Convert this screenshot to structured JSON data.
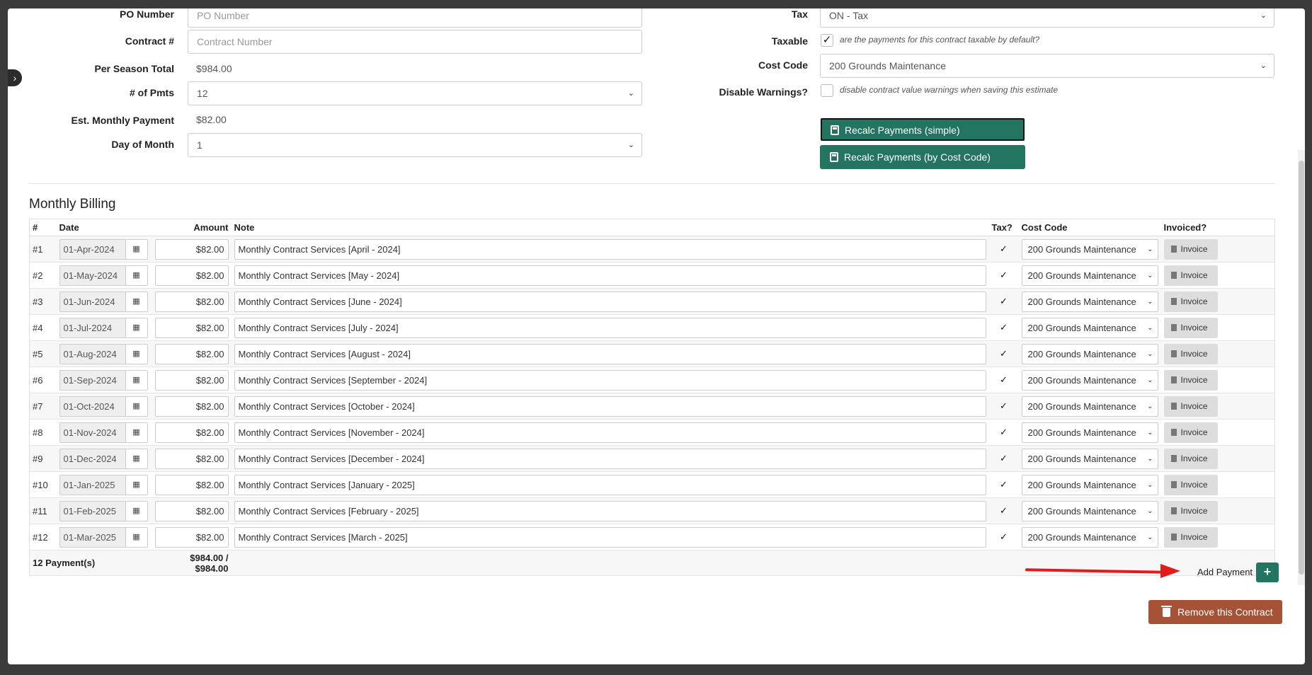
{
  "form": {
    "po_number": {
      "label": "PO Number",
      "placeholder": "PO Number"
    },
    "contract_no": {
      "label": "Contract #",
      "placeholder": "Contract Number"
    },
    "per_season_total": {
      "label": "Per Season Total",
      "value": "$984.00"
    },
    "num_pmts": {
      "label": "# of Pmts",
      "value": "12"
    },
    "est_monthly": {
      "label": "Est. Monthly Payment",
      "value": "$82.00"
    },
    "day_of_month": {
      "label": "Day of Month",
      "value": "1"
    },
    "tax": {
      "label": "Tax",
      "value": "ON - Tax"
    },
    "taxable": {
      "label": "Taxable",
      "checked": true,
      "hint": "are the payments for this contract taxable by default?"
    },
    "cost_code": {
      "label": "Cost Code",
      "value": "200 Grounds Maintenance"
    },
    "disable_warnings": {
      "label": "Disable Warnings?",
      "checked": false,
      "hint": "disable contract value warnings when saving this estimate"
    },
    "recalc_simple": "Recalc Payments (simple)",
    "recalc_cost_code": "Recalc Payments (by Cost Code)"
  },
  "billing": {
    "title": "Monthly Billing",
    "headers": {
      "num": "#",
      "date": "Date",
      "amount": "Amount",
      "note": "Note",
      "tax": "Tax?",
      "cost_code": "Cost Code",
      "invoiced": "Invoiced?"
    },
    "rows": [
      {
        "num": "#1",
        "date": "01-Apr-2024",
        "amount": "$82.00",
        "note": "Monthly Contract Services [April - 2024]",
        "tax": true,
        "cost_code": "200 Grounds Maintenance",
        "invoice": "Invoice"
      },
      {
        "num": "#2",
        "date": "01-May-2024",
        "amount": "$82.00",
        "note": "Monthly Contract Services [May - 2024]",
        "tax": true,
        "cost_code": "200 Grounds Maintenance",
        "invoice": "Invoice"
      },
      {
        "num": "#3",
        "date": "01-Jun-2024",
        "amount": "$82.00",
        "note": "Monthly Contract Services [June - 2024]",
        "tax": true,
        "cost_code": "200 Grounds Maintenance",
        "invoice": "Invoice"
      },
      {
        "num": "#4",
        "date": "01-Jul-2024",
        "amount": "$82.00",
        "note": "Monthly Contract Services [July - 2024]",
        "tax": true,
        "cost_code": "200 Grounds Maintenance",
        "invoice": "Invoice"
      },
      {
        "num": "#5",
        "date": "01-Aug-2024",
        "amount": "$82.00",
        "note": "Monthly Contract Services [August - 2024]",
        "tax": true,
        "cost_code": "200 Grounds Maintenance",
        "invoice": "Invoice"
      },
      {
        "num": "#6",
        "date": "01-Sep-2024",
        "amount": "$82.00",
        "note": "Monthly Contract Services [September - 2024]",
        "tax": true,
        "cost_code": "200 Grounds Maintenance",
        "invoice": "Invoice"
      },
      {
        "num": "#7",
        "date": "01-Oct-2024",
        "amount": "$82.00",
        "note": "Monthly Contract Services [October - 2024]",
        "tax": true,
        "cost_code": "200 Grounds Maintenance",
        "invoice": "Invoice"
      },
      {
        "num": "#8",
        "date": "01-Nov-2024",
        "amount": "$82.00",
        "note": "Monthly Contract Services [November - 2024]",
        "tax": true,
        "cost_code": "200 Grounds Maintenance",
        "invoice": "Invoice"
      },
      {
        "num": "#9",
        "date": "01-Dec-2024",
        "amount": "$82.00",
        "note": "Monthly Contract Services [December - 2024]",
        "tax": true,
        "cost_code": "200 Grounds Maintenance",
        "invoice": "Invoice"
      },
      {
        "num": "#10",
        "date": "01-Jan-2025",
        "amount": "$82.00",
        "note": "Monthly Contract Services [January - 2025]",
        "tax": true,
        "cost_code": "200 Grounds Maintenance",
        "invoice": "Invoice"
      },
      {
        "num": "#11",
        "date": "01-Feb-2025",
        "amount": "$82.00",
        "note": "Monthly Contract Services [February - 2025]",
        "tax": true,
        "cost_code": "200 Grounds Maintenance",
        "invoice": "Invoice"
      },
      {
        "num": "#12",
        "date": "01-Mar-2025",
        "amount": "$82.00",
        "note": "Monthly Contract Services [March - 2025]",
        "tax": true,
        "cost_code": "200 Grounds Maintenance",
        "invoice": "Invoice"
      }
    ],
    "footer": {
      "count": "12 Payment(s)",
      "total": "$984.00 / $984.00",
      "add_label": "Add Payment",
      "add_icon": "+"
    }
  },
  "remove_contract": "Remove this Contract",
  "colors": {
    "primary_green": "#237561",
    "remove_brown": "#a65237",
    "annotation_red": "#e31b1b"
  }
}
